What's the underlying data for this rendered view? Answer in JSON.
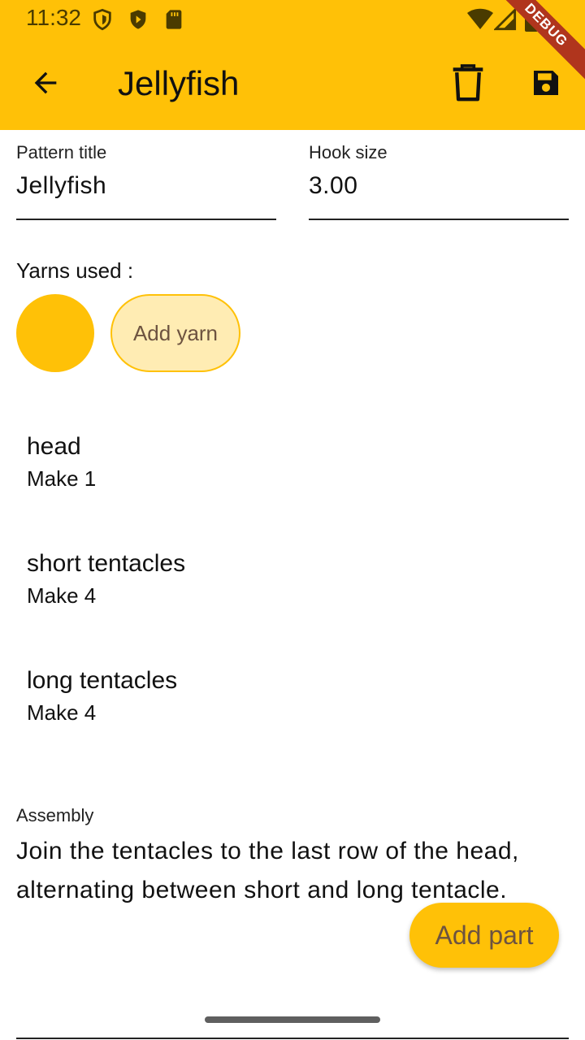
{
  "status_bar": {
    "time": "11:32"
  },
  "debug_banner": "DEBUG",
  "app_bar": {
    "title": "Jellyfish"
  },
  "form": {
    "pattern_title_label": "Pattern title",
    "pattern_title_value": "Jellyfish",
    "hook_size_label": "Hook size",
    "hook_size_value": "3.00"
  },
  "yarns": {
    "label": "Yarns used :",
    "colors": [
      "#FFC107"
    ],
    "add_label": "Add yarn"
  },
  "parts": [
    {
      "name": "head",
      "make": "Make 1"
    },
    {
      "name": "short tentacles",
      "make": "Make 4"
    },
    {
      "name": "long tentacles",
      "make": "Make 4"
    }
  ],
  "assembly": {
    "label": "Assembly",
    "text": "Join the tentacles to the last row of the head, alternating between short and long tentacle."
  },
  "fab": {
    "label": "Add part"
  },
  "colors": {
    "accent": "#FFC107",
    "accent_light": "#FFECB3",
    "debug": "#B0351D"
  },
  "icons": [
    "shield-icon",
    "play-store-icon",
    "sd-card-icon",
    "wifi-icon",
    "signal-icon",
    "battery-icon",
    "back-arrow-icon",
    "delete-icon",
    "save-icon"
  ]
}
